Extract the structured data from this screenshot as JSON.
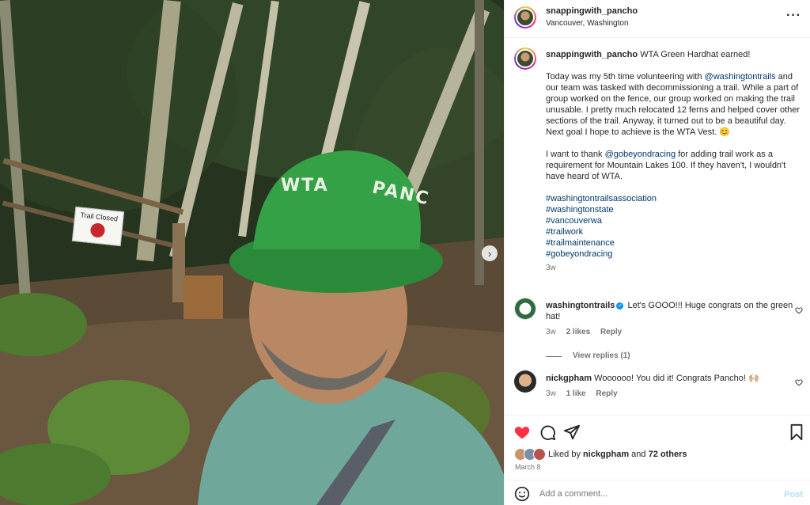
{
  "post": {
    "username": "snappingwith_pancho",
    "location": "Vancouver, Washington",
    "caption_title": "WTA Green Hardhat earned!",
    "caption_p1_a": "Today was my 5th time volunteering with ",
    "caption_p1_mention": "@washingtontrails",
    "caption_p1_b": " and our team was tasked with decommissioning a trail. While a part of group worked on the fence, our group worked on making the trail unusable. I pretty much relocated 12 ferns and helped cover other sections of the trail. Anyway, it turned out to be a beautiful day. Next goal I hope to achieve is the WTA Vest. 😊",
    "caption_p2_a": "I want to thank ",
    "caption_p2_mention": "@gobeyondracing",
    "caption_p2_b": " for adding trail work as a requirement for Mountain Lakes 100. If they haven't, I wouldn't have heard of WTA.",
    "hashtags": [
      "#washingtontrailsassociation",
      "#washingtonstate",
      "#vancouverwa",
      "#trailwork",
      "#trailmaintenance",
      "#gobeyondracing"
    ],
    "caption_time": "3w"
  },
  "photo": {
    "sign_text": "Trail Closed",
    "hat_text_left": "WTA",
    "hat_text_right": "PANC"
  },
  "comments": [
    {
      "username": "washingtontrails",
      "text": "Let's GOOO!!! Huge congrats on the green hat!",
      "time": "3w",
      "likes": "2 likes",
      "reply": "Reply",
      "view_replies": "View replies (1)"
    },
    {
      "username": "nickgpham",
      "text": "Woooooo! You did it! Congrats Pancho! 🙌🏼",
      "time": "3w",
      "likes": "1 like",
      "reply": "Reply"
    }
  ],
  "actions": {
    "liked_by_prefix": "Liked by ",
    "liked_by_user": "nickgpham",
    "liked_by_and": " and ",
    "liked_by_others": "72 others",
    "date": "March 8"
  },
  "add_comment": {
    "placeholder": "Add a comment...",
    "post_label": "Post"
  },
  "icons": {
    "more": "more-horizontal-icon",
    "like": "heart-icon",
    "comment": "comment-icon",
    "share": "share-icon",
    "save": "bookmark-icon",
    "emoji": "emoji-icon",
    "next": "chevron-right-icon"
  },
  "colors": {
    "like_red": "#ff3040",
    "link_blue": "#00376b",
    "verified_blue": "#0095f6",
    "post_disabled": "#b3dbff"
  }
}
